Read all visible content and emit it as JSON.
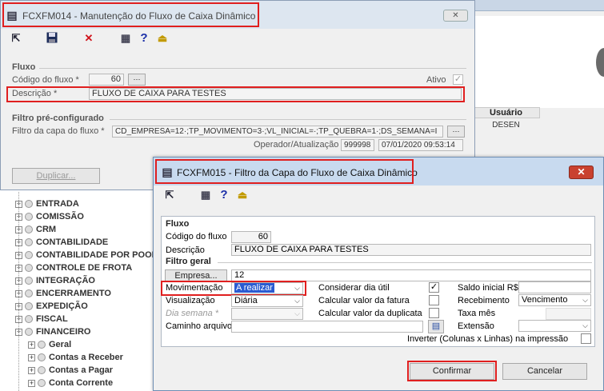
{
  "bg_window": {
    "col_usuario": "Usuário",
    "cell_user": "DESEN"
  },
  "tree": [
    {
      "label": "ENTRADA",
      "level": 0
    },
    {
      "label": "COMISSÃO",
      "level": 0
    },
    {
      "label": "CRM",
      "level": 0
    },
    {
      "label": "CONTABILIDADE",
      "level": 0
    },
    {
      "label": "CONTABILIDADE POR POOL",
      "level": 0
    },
    {
      "label": "CONTROLE DE FROTA",
      "level": 0
    },
    {
      "label": "INTEGRAÇÃO",
      "level": 0
    },
    {
      "label": "ENCERRAMENTO",
      "level": 0
    },
    {
      "label": "EXPEDIÇÃO",
      "level": 0
    },
    {
      "label": "FISCAL",
      "level": 0
    },
    {
      "label": "FINANCEIRO",
      "level": 0
    },
    {
      "label": "Geral",
      "level": 1
    },
    {
      "label": "Contas a Receber",
      "level": 1
    },
    {
      "label": "Contas a Pagar",
      "level": 1
    },
    {
      "label": "Conta Corrente",
      "level": 1
    }
  ],
  "win1": {
    "title": "FCXFM014 - Manutenção do Fluxo de Caixa Dinâmico",
    "close_glyph": "✕",
    "toolbar": {
      "nav_icon": "⇱",
      "save_icon": "💾",
      "delete_icon": "✕",
      "calc_icon": "▦",
      "help_icon": "?",
      "exit_icon": "⏏"
    },
    "fluxo_section": "Fluxo",
    "codigo_label": "Código do fluxo *",
    "codigo_value": "60",
    "ativo_label": "Ativo",
    "ativo_check": "✓",
    "descricao_label": "Descrição *",
    "descricao_value": "FLUXO DE CAIXA PARA TESTES",
    "filtro_section": "Filtro pré-configurado",
    "filtro_label": "Filtro da capa do fluxo *",
    "filtro_value": "CD_EMPRESA=12·;TP_MOVIMENTO=3·;VL_INICIAL=·;TP_QUEBRA=1·;DS_SEMANA=I",
    "operador_label": "Operador/Atualização",
    "operador_value": "999998",
    "data_value": "07/01/2020 09:53:14",
    "duplicar_label": "Duplicar..."
  },
  "win2": {
    "title": "FCXFM015 - Filtro da Capa do Fluxo de Caixa Dinâmico",
    "close_glyph": "✕",
    "toolbar": {
      "nav_icon": "⇱",
      "calc_icon": "▦",
      "help_icon": "?",
      "exit_icon": "⏏"
    },
    "fluxo_section": "Fluxo",
    "codigo_label": "Código do fluxo",
    "codigo_value": "60",
    "descricao_label": "Descrição",
    "descricao_value": "FLUXO DE CAIXA PARA TESTES",
    "filtro_section": "Filtro geral",
    "empresa_button": "Empresa...",
    "empresa_value": "12",
    "movimentacao_label": "Movimentação",
    "movimentacao_value": "A realizar",
    "visualizacao_label": "Visualização",
    "visualizacao_value": "Diária",
    "dia_semana_label": "Dia semana *",
    "dia_semana_value": "",
    "caminho_label": "Caminho arquivo",
    "caminho_value": "",
    "considerar_label": "Considerar dia útil",
    "considerar_check": "✓",
    "calc_fatura_label": "Calcular valor da fatura",
    "calc_duplicata_label": "Calcular valor da duplicata",
    "saldo_label": "Saldo inicial R$",
    "saldo_value": "",
    "recebimento_label": "Recebimento",
    "recebimento_value": "Vencimento",
    "taxa_label": "Taxa mês",
    "taxa_value": "",
    "extensao_label": "Extensão",
    "extensao_value": "",
    "inverter_label": "Inverter (Colunas x Linhas) na impressão",
    "confirmar_label": "Confirmar",
    "cancelar_label": "Cancelar",
    "arrow": "⌵"
  }
}
